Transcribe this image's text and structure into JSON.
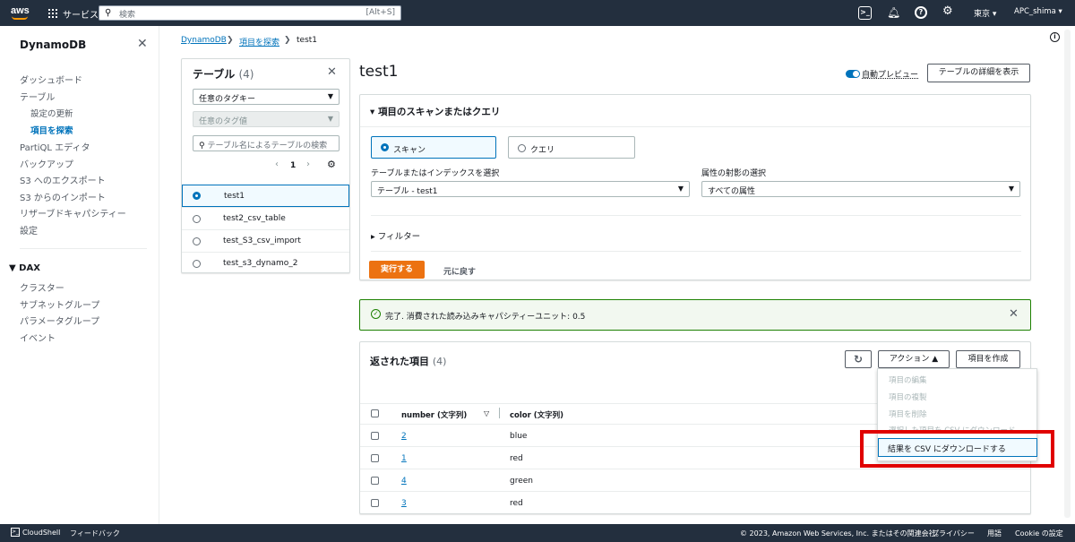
{
  "topbar": {
    "logo": "aws",
    "services": "サービス",
    "search_placeholder": "検索",
    "search_shortcut": "[Alt+S]",
    "region": "東京 ▾",
    "user": "APC_shima ▾",
    "icons": [
      "cloudshell-icon",
      "bell-icon",
      "help-icon",
      "gear-icon"
    ]
  },
  "leftnav": {
    "title": "DynamoDB",
    "items": [
      "ダッシュボード",
      "テーブル",
      "設定の更新",
      "項目を探索",
      "PartiQL エディタ",
      "バックアップ",
      "S3 へのエクスポート",
      "S3 からのインポート",
      "リザーブドキャパシティー",
      "設定"
    ],
    "dax_header": "DAX",
    "dax_items": [
      "クラスター",
      "サブネットグループ",
      "パラメータグループ",
      "イベント"
    ]
  },
  "breadcrumb": [
    "DynamoDB",
    "項目を探索",
    "test1"
  ],
  "tables": {
    "title": "テーブル",
    "count": "(4)",
    "tag_key": "任意のタグキー",
    "tag_value": "任意のタグ値",
    "search_placeholder": "テーブル名によるテーブルの検索",
    "page": "1",
    "items": [
      "test1",
      "test2_csv_table",
      "test_S3_csv_import",
      "test_s3_dynamo_2"
    ]
  },
  "main": {
    "title": "test1",
    "auto_preview": "自動プレビュー",
    "view_details": "テーブルの詳細を表示",
    "scan_title": "項目のスキャンまたはクエリ",
    "scan": "スキャン",
    "query": "クエリ",
    "table_index_label": "テーブルまたはインデックスを選択",
    "table_index_value": "テーブル - test1",
    "projection_label": "属性の射影の選択",
    "projection_value": "すべての属性",
    "filter": "フィルター",
    "run": "実行する",
    "reset": "元に戻す",
    "success": "完了. 消費された読み込みキャパシティーユニット: 0.5"
  },
  "results": {
    "title": "返された項目",
    "count": "(4)",
    "actions": "アクション",
    "create": "項目を作成",
    "menu": [
      "項目の編集",
      "項目の複製",
      "項目を削除",
      "選択した項目を CSV にダウンロード",
      "結果を CSV にダウンロードする"
    ],
    "col_number": "number (文字列)",
    "col_color": "color (文字列)",
    "rows": [
      {
        "number": "2",
        "color": "blue"
      },
      {
        "number": "1",
        "color": "red"
      },
      {
        "number": "4",
        "color": "green"
      },
      {
        "number": "3",
        "color": "red"
      }
    ]
  },
  "footer": {
    "cloudshell": "CloudShell",
    "feedback": "フィードバック",
    "copyright": "© 2023, Amazon Web Services, Inc. またはその関連会社。",
    "privacy": "プライバシー",
    "terms": "用語",
    "cookie": "Cookie の設定"
  },
  "colors": {
    "nav": "#232f3e",
    "accent": "#ec7211",
    "link": "#0073bb",
    "highlight": "#e00000"
  }
}
